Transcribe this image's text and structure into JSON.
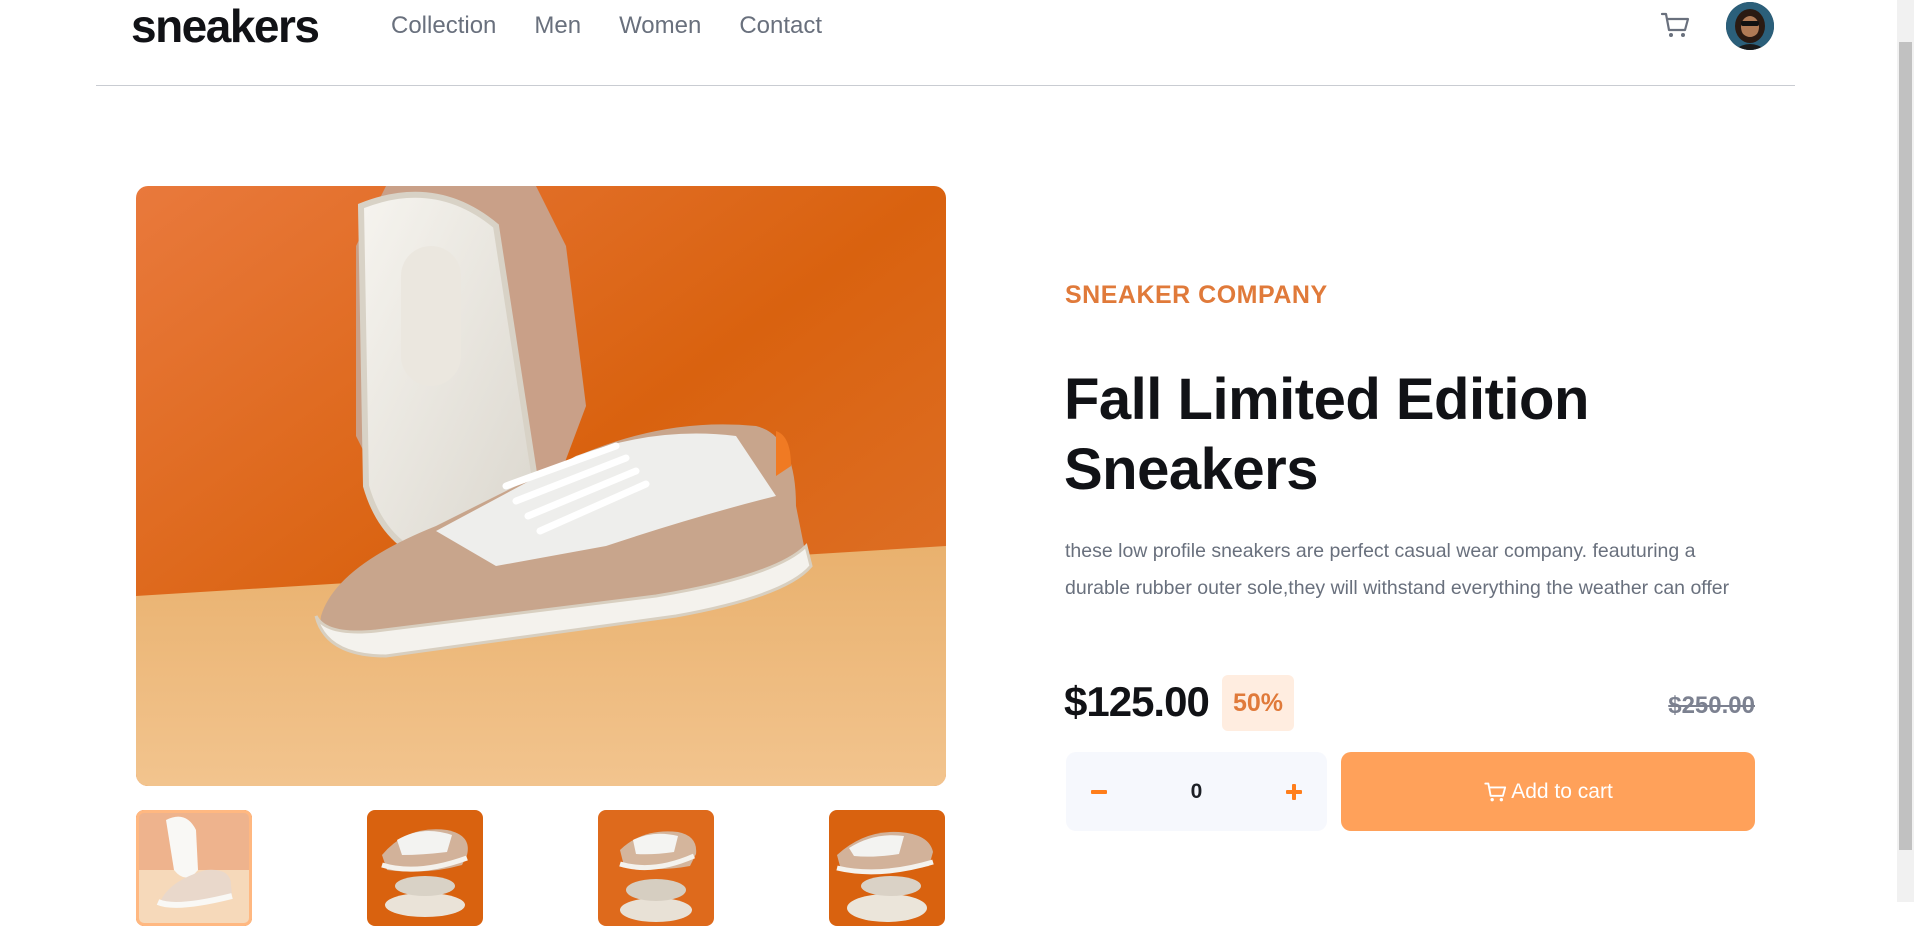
{
  "header": {
    "logo": "sneakers",
    "nav": [
      {
        "label": "Collection"
      },
      {
        "label": "Men"
      },
      {
        "label": "Women"
      },
      {
        "label": "Contact"
      }
    ],
    "cart_icon": "cart-icon",
    "avatar_icon": "user-avatar"
  },
  "gallery": {
    "thumbnails": [
      {
        "name": "thumbnail-1",
        "active": true
      },
      {
        "name": "thumbnail-2",
        "active": false
      },
      {
        "name": "thumbnail-3",
        "active": false
      },
      {
        "name": "thumbnail-4",
        "active": false
      }
    ]
  },
  "product": {
    "company": "SNEAKER COMPANY",
    "title": "Fall Limited Edition Sneakers",
    "description": "these low profile sneakers are perfect casual wear company. feauturing a durable rubber outer sole,they will withstand everything the weather can offer",
    "price": "$125.00",
    "discount": "50%",
    "original_price": "$250.00"
  },
  "cart_controls": {
    "quantity": "0",
    "minus_icon": "minus-icon",
    "plus_icon": "plus-icon",
    "add_label": "Add to cart"
  },
  "colors": {
    "accent": "#ff7e1b",
    "button": "#ffa15a",
    "discount_bg": "#ffede0",
    "text_muted": "#69707d"
  }
}
